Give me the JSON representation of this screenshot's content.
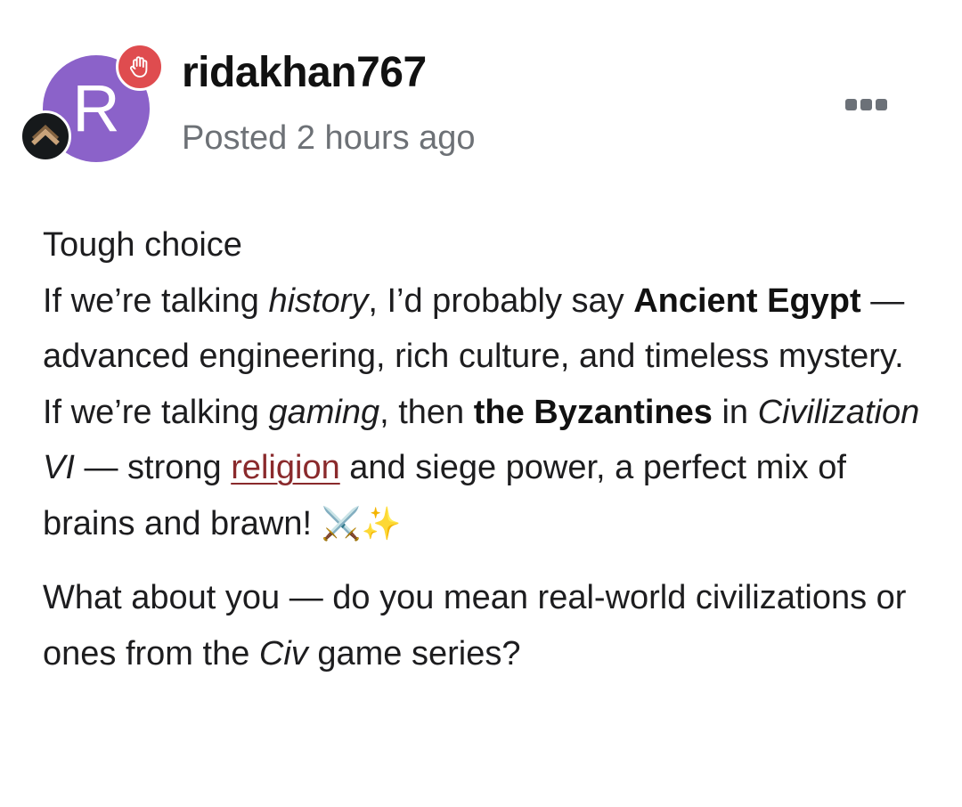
{
  "post": {
    "author": {
      "avatar_initial": "R",
      "avatar_color": "#8b62c9",
      "username": "ridakhan767",
      "mod_badge_icon": "raised-hand-icon",
      "mod_badge_color": "#df4c4f",
      "rank_badge_icon": "chevron-up-rank-icon"
    },
    "timestamp": "Posted 2 hours ago",
    "menu_icon": "more-options-icon",
    "body": {
      "p1_line1": "Tough choice",
      "p1_s1": "If we’re talking ",
      "p1_s1_em": "history",
      "p1_s2": ", I’d probably say ",
      "p1_s2_strong": "Ancient Egypt",
      "p1_s3": " — advanced engineering, rich culture, and timeless mystery.",
      "p1_s4": "If we’re talking ",
      "p1_s4_em": "gaming",
      "p1_s5": ", then ",
      "p1_s5_strong": "the Byzantines",
      "p1_s6": " in ",
      "p1_s6_em": "Civilization VI",
      "p1_s7": " — strong ",
      "p1_link": "religion",
      "p1_s8": " and siege power, a perfect mix of brains and brawn! ",
      "p1_emoji": "⚔️✨",
      "p2_s1": "What about you — do you mean real-world civilizations or ones from the ",
      "p2_em": "Civ",
      "p2_s2": " game series?"
    },
    "link_color": "#8a2a2c"
  }
}
